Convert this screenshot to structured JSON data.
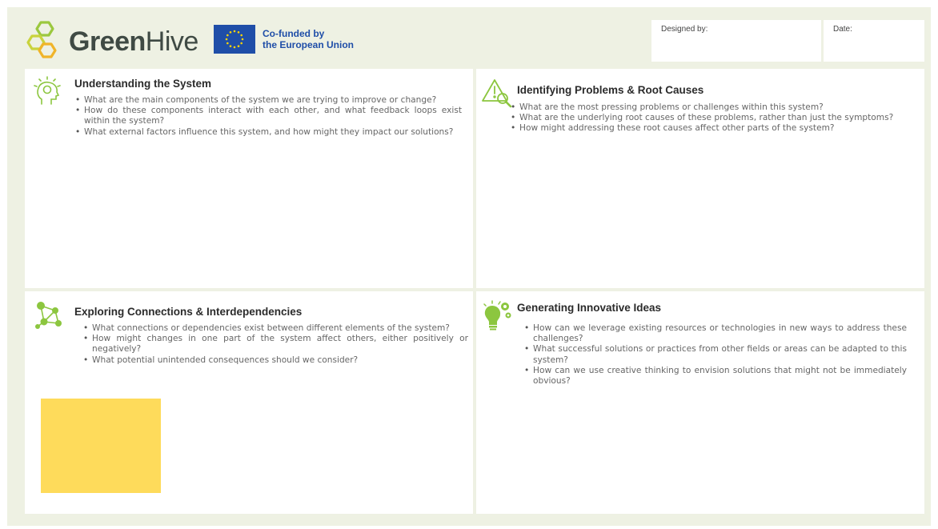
{
  "brand": {
    "name_bold": "Green",
    "name_light": "Hive"
  },
  "eu": {
    "line1": "Co-funded by",
    "line2": "the European Union"
  },
  "meta": {
    "designed_by_label": "Designed by:",
    "date_label": "Date:"
  },
  "colors": {
    "green_accent": "#8cc63f",
    "background": "#eef1e3",
    "eu_blue": "#1f4ea8",
    "sticky_note": "#fedb5b"
  },
  "sections": [
    {
      "icon": "head-lightbulb-icon",
      "title": "Understanding the System",
      "questions": [
        "What are the main components of the system we are trying to improve or change?",
        "How do these components interact with each other, and what feedback loops exist within the system?",
        "What external factors influence this system, and how might they impact our solutions?"
      ]
    },
    {
      "icon": "warning-magnifier-icon",
      "title": "Identifying Problems & Root Causes",
      "questions": [
        "What are the most pressing problems or challenges within this system?",
        "What are the underlying root causes of these problems, rather than just the symptoms?",
        "How might addressing these root causes affect other parts of the system?"
      ]
    },
    {
      "icon": "network-nodes-icon",
      "title": "Exploring Connections & Interdependencies",
      "questions": [
        "What connections or dependencies exist between different elements of the system?",
        "How might changes in one part of the system affect others, either positively or negatively?",
        "What potential unintended consequences should we consider?"
      ]
    },
    {
      "icon": "lightbulb-gears-icon",
      "title": "Generating Innovative Ideas",
      "questions": [
        "How can we leverage existing resources or technologies in new ways to address these challenges?",
        "What successful solutions or practices from other fields or areas can be adapted to this system?",
        "How can we use creative thinking to envision solutions that might not be immediately obvious?"
      ]
    }
  ]
}
